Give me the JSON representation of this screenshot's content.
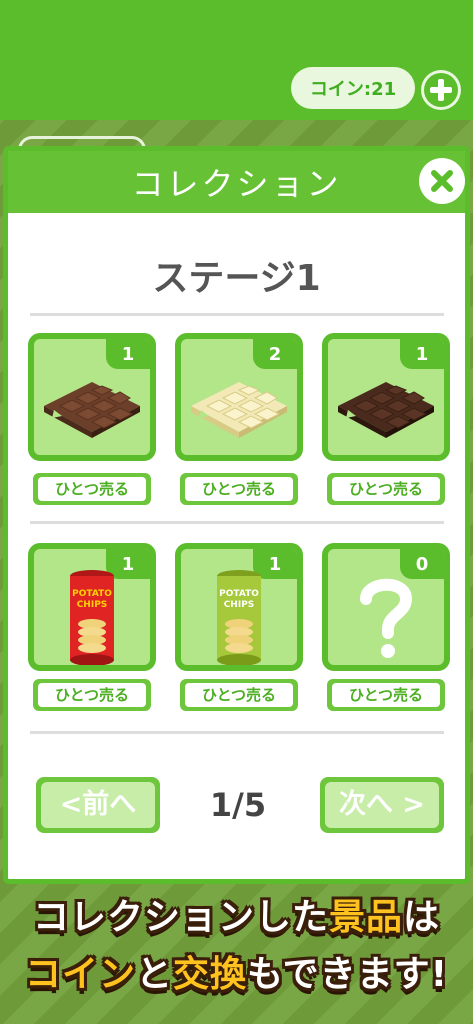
{
  "header": {
    "coin_label": "コイン:21",
    "add_coin_icon": "plus-circle-icon"
  },
  "dialog": {
    "title": "コレクション",
    "close_icon": "close-icon",
    "stage_title": "ステージ1",
    "items": [
      {
        "name": "milk-chocolate",
        "count": "1",
        "icon": "milk-chocolate-bar-icon",
        "sell_label": "ひとつ売る"
      },
      {
        "name": "white-chocolate",
        "count": "2",
        "icon": "white-chocolate-bar-icon",
        "sell_label": "ひとつ売る"
      },
      {
        "name": "dark-chocolate",
        "count": "1",
        "icon": "dark-chocolate-bar-icon",
        "sell_label": "ひとつ売る"
      },
      {
        "name": "potato-chips-red",
        "count": "1",
        "icon": "potato-chips-red-can-icon",
        "sell_label": "ひとつ売る",
        "can_text_1": "POTATO",
        "can_text_2": "CHIPS"
      },
      {
        "name": "potato-chips-green",
        "count": "1",
        "icon": "potato-chips-green-can-icon",
        "sell_label": "ひとつ売る",
        "can_text_1": "POTATO",
        "can_text_2": "CHIPS"
      },
      {
        "name": "unknown",
        "count": "0",
        "icon": "question-mark-icon",
        "sell_label": "ひとつ売る"
      }
    ],
    "prev_label": "<前へ",
    "page_indicator": "1/5",
    "next_label": "次へ >"
  },
  "banner": {
    "line1_a": "コレクションした",
    "line1_b": "景品",
    "line1_c": "は",
    "line2_a": "コイン",
    "line2_b": "と",
    "line2_c": "交換",
    "line2_d": "もできます!"
  },
  "colors": {
    "primary_green": "#5bbd2b",
    "slot_bg": "#b2e689",
    "banner_highlight": "#ffc21e"
  }
}
